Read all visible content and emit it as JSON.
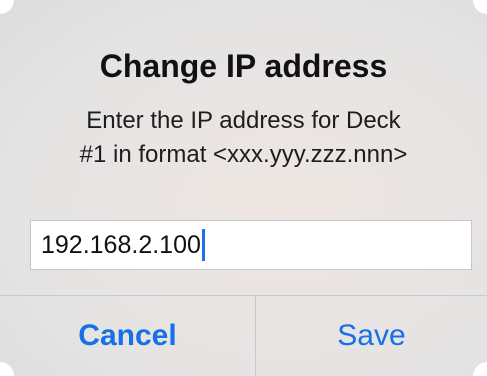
{
  "dialog": {
    "title": "Change IP address",
    "message_line1": "Enter the IP address for Deck",
    "message_line2": "#1 in format <xxx.yyy.zzz.nnn>",
    "input": {
      "value": "192.168.2.100"
    },
    "buttons": {
      "cancel_label": "Cancel",
      "save_label": "Save"
    }
  },
  "colors": {
    "accent": "#1670e6",
    "caret": "#1a73e8",
    "dialog_background": "#e4e3e3"
  }
}
